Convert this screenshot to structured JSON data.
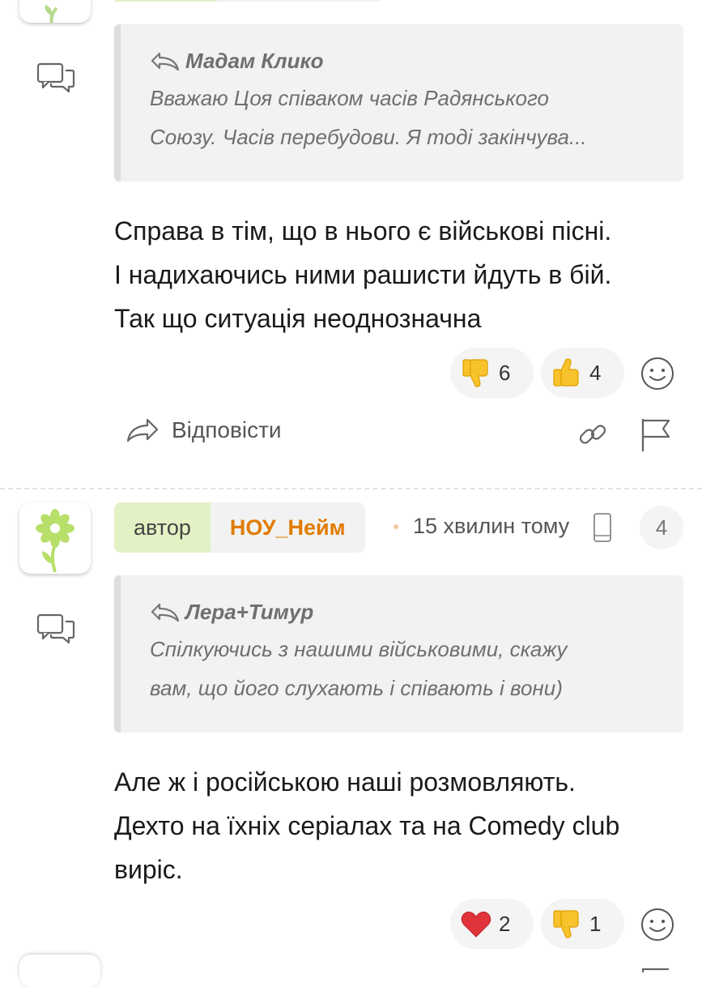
{
  "comment1": {
    "quote": {
      "author": "Мадам Клико",
      "text_line1": "Вважаю Цоя співаком часів Радянського",
      "text_line2": "Союзу. Часів перебудови. Я тоді закінчува..."
    },
    "body": [
      "Справа в тім, що в нього є військові пісні.",
      "І надихаючись ними рашисти йдуть в бій.",
      "Так що ситуація неоднозначна"
    ],
    "reactions": [
      {
        "icon": "thumbs-down-icon",
        "count": "6"
      },
      {
        "icon": "thumbs-up-icon",
        "count": "4"
      }
    ],
    "reply_label": "Відповісти"
  },
  "comment2": {
    "author_label": "автор",
    "nickname": "НОУ_Нейм",
    "time": "15 хвилин тому",
    "reply_count": "4",
    "quote": {
      "author": "Лера+Тимур",
      "text_line1": "Спілкуючись з нашими військовими, скажу",
      "text_line2": "вам, що його слухають і співають і вони)"
    },
    "body": [
      "Але ж і російською наші розмовляють.",
      "Дехто на їхніх серіалах та на Comedy club",
      "виріс."
    ],
    "reactions": [
      {
        "icon": "heart-icon",
        "count": "2"
      },
      {
        "icon": "thumbs-down-icon",
        "count": "1"
      }
    ]
  },
  "colors": {
    "nickname": "#e07c00",
    "author_tag_bg": "#e3f2c4",
    "quote_bg": "#f2f2f2"
  }
}
